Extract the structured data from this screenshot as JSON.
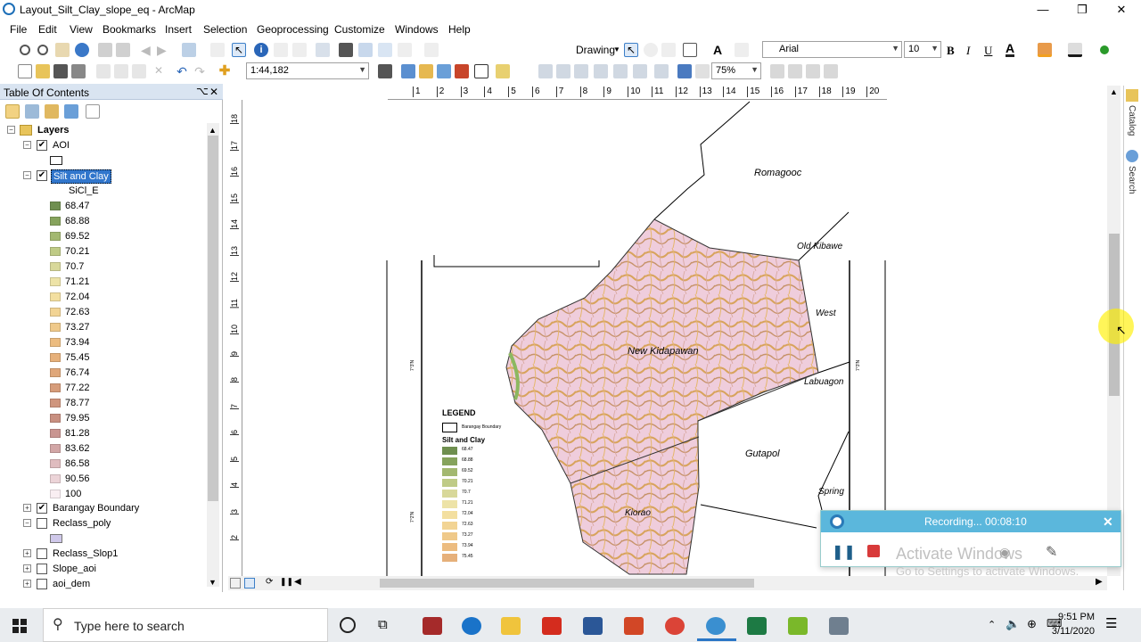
{
  "window": {
    "title": "Layout_Silt_Clay_slope_eq - ArcMap",
    "minimize": "—",
    "restore": "❐",
    "close": "✕"
  },
  "menu": [
    "File",
    "Edit",
    "View",
    "Bookmarks",
    "Insert",
    "Selection",
    "Geoprocessing",
    "Customize",
    "Windows",
    "Help"
  ],
  "toolbar": {
    "drawing_label": "Drawing",
    "font_name": "Arial",
    "font_size": "10",
    "bold": "B",
    "italic": "I",
    "underline": "U",
    "text_tool": "A",
    "scale": "1:44,182",
    "zoom_percent": "75%"
  },
  "toc": {
    "title": "Table Of Contents",
    "pin": "⌥",
    "close": "✕",
    "layers_label": "Layers",
    "layers": [
      {
        "name": "AOI",
        "checked": true,
        "expanded": true
      },
      {
        "name": "Silt and Clay",
        "checked": true,
        "expanded": true,
        "selected": true,
        "field": "SiCl_E"
      },
      {
        "name": "Barangay Boundary",
        "checked": true,
        "expanded": false
      },
      {
        "name": "Reclass_poly",
        "checked": false,
        "expanded": true
      },
      {
        "name": "Reclass_Slop1",
        "checked": false,
        "expanded": false
      },
      {
        "name": "Slope_aoi",
        "checked": false,
        "expanded": false
      },
      {
        "name": "aoi_dem",
        "checked": false,
        "expanded": false
      }
    ],
    "classes": [
      {
        "value": "68.47",
        "color": "#6f8f4f"
      },
      {
        "value": "68.88",
        "color": "#86a35c"
      },
      {
        "value": "69.52",
        "color": "#a3b870"
      },
      {
        "value": "70.21",
        "color": "#bfcb86"
      },
      {
        "value": "70.7",
        "color": "#d8d89a"
      },
      {
        "value": "71.21",
        "color": "#ede3a7"
      },
      {
        "value": "72.04",
        "color": "#f3dfa0"
      },
      {
        "value": "72.63",
        "color": "#f2d494"
      },
      {
        "value": "73.27",
        "color": "#efc98a"
      },
      {
        "value": "73.94",
        "color": "#ecbc80"
      },
      {
        "value": "75.45",
        "color": "#e6b07a"
      },
      {
        "value": "76.74",
        "color": "#dfa77a"
      },
      {
        "value": "77.22",
        "color": "#d69c7a"
      },
      {
        "value": "78.77",
        "color": "#cf957d"
      },
      {
        "value": "79.95",
        "color": "#c88f80"
      },
      {
        "value": "81.28",
        "color": "#c99591"
      },
      {
        "value": "83.62",
        "color": "#d2a6a6"
      },
      {
        "value": "86.58",
        "color": "#dfbcbf"
      },
      {
        "value": "90.56",
        "color": "#ecd4d8"
      },
      {
        "value": "100",
        "color": "#f9eef2"
      }
    ]
  },
  "map": {
    "places": [
      "Romagooc",
      "Old Kibawe",
      "West",
      "New Kidapawan",
      "Labuagon",
      "Gutapol",
      "Spring",
      "Kiorao"
    ],
    "legend_title": "LEGEND",
    "legend_boundary": "Barangay Boundary",
    "legend_layer": "Silt and Clay",
    "legend_values": [
      "68.47",
      "68.88",
      "69.52",
      "70.21",
      "70.7",
      "71.21",
      "72.04",
      "72.63",
      "73.27",
      "73.94",
      "75.45"
    ],
    "h_ruler": [
      "1",
      "2",
      "3",
      "4",
      "5",
      "6",
      "7",
      "8",
      "9",
      "10",
      "11",
      "12",
      "13",
      "14",
      "15",
      "16",
      "17",
      "18",
      "19",
      "20"
    ],
    "v_ruler": [
      "18",
      "17",
      "16",
      "15",
      "14",
      "13",
      "12",
      "11",
      "10",
      "9",
      "8",
      "7",
      "6",
      "5",
      "4",
      "3",
      "2"
    ]
  },
  "catalog": {
    "catalog_label": "Catalog",
    "search_label": "Search"
  },
  "recording": {
    "status": "Recording... 00:08:10",
    "watermark_title": "Activate Windows",
    "watermark_sub": "Go to Settings to activate Windows."
  },
  "taskbar": {
    "search_placeholder": "Type here to search",
    "time": "9:51 PM",
    "date": "3/11/2020"
  }
}
